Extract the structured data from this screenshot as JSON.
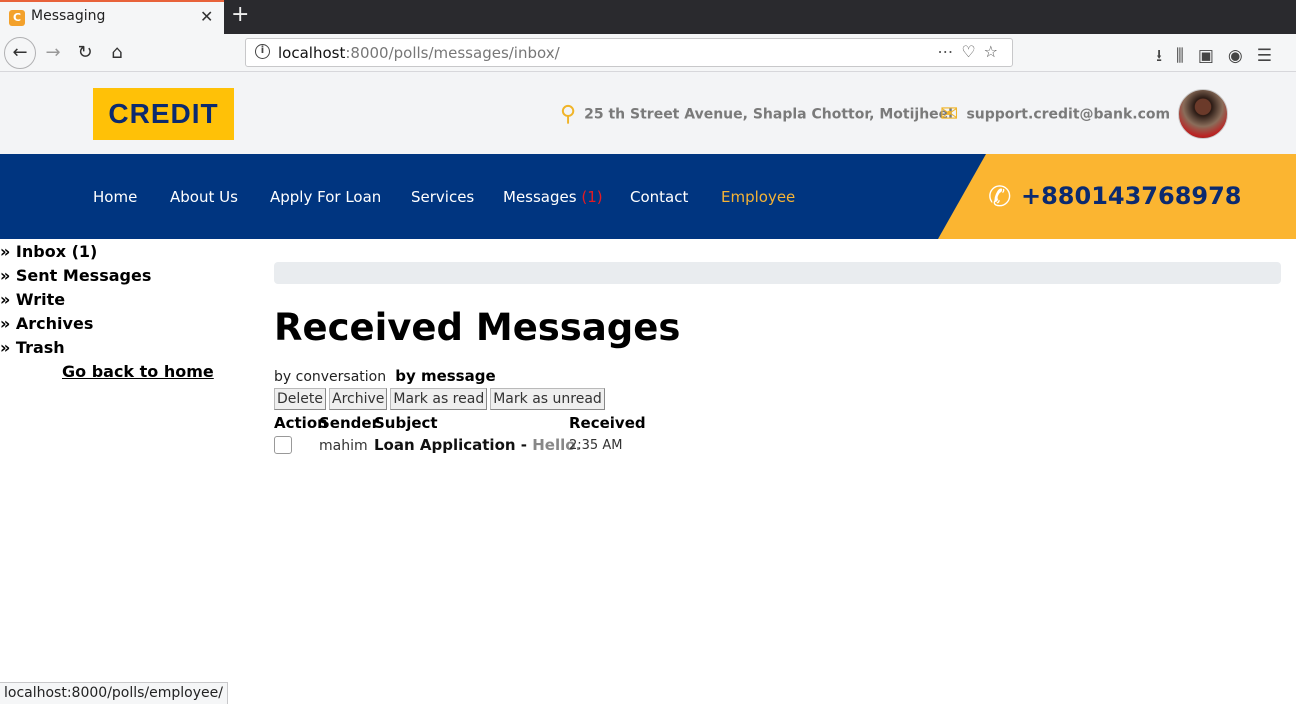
{
  "browser": {
    "tab_title": "Messaging",
    "favicon_letter": "C",
    "url_host": "localhost",
    "url_path": ":8000/polls/messages/inbox/",
    "status_url": "localhost:8000/polls/employee/"
  },
  "site": {
    "logo": "CREDIT",
    "address": "25 th Street Avenue, Shapla Chottor, Motijheel",
    "email": "support.credit@bank.com",
    "phone": "+880143768978",
    "colors": {
      "brand_navy": "#003580",
      "brand_yellow": "#ffc107",
      "accent_orange": "#fbb531",
      "alert_red": "#e31b23"
    }
  },
  "nav": {
    "home": "Home",
    "about": "About Us",
    "apply": "Apply For Loan",
    "services": "Services",
    "messages": "Messages",
    "messages_count": "(1)",
    "contact": "Contact",
    "employee": "Employee"
  },
  "sidebar": {
    "items": [
      {
        "label": "» Inbox (1)"
      },
      {
        "label": "» Sent Messages"
      },
      {
        "label": "» Write"
      },
      {
        "label": "» Archives"
      },
      {
        "label": "» Trash"
      }
    ],
    "home_link": "Go back to home"
  },
  "main": {
    "title": "Received Messages",
    "view_conversation": "by conversation",
    "view_message": "by message",
    "actions": {
      "delete": "Delete",
      "archive": "Archive",
      "mark_read": "Mark as read",
      "mark_unread": "Mark as unread"
    },
    "columns": {
      "action": "Action",
      "sender": "Sender",
      "subject": "Subject",
      "received": "Received"
    },
    "rows": [
      {
        "sender": "mahim",
        "subject": "Loan Application - ",
        "snippet": "Hello.",
        "received": "2:35 AM"
      }
    ]
  }
}
